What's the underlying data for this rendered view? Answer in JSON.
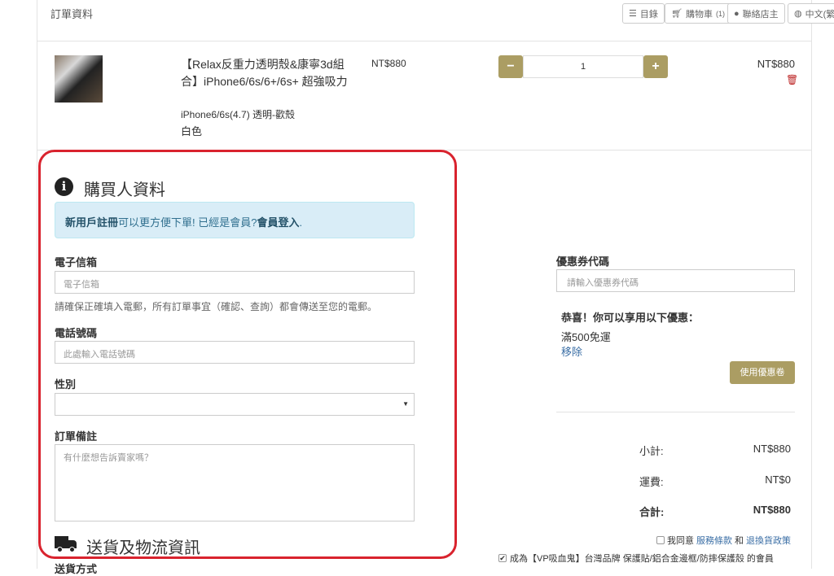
{
  "header": {
    "title": "訂單資料"
  },
  "nav": {
    "menu": "目錄",
    "cart": "購物車",
    "cart_count": "(1)",
    "contact": "聯絡店主",
    "language": "中文(繁"
  },
  "product": {
    "name": "【Relax反重力透明殼&康寧3d組合】iPhone6/6s/6+/6s+ 超強吸力",
    "variant": "iPhone6/6s(4.7) 透明-歡殼",
    "color": "白色",
    "unit_price": "NT$880",
    "quantity": "1",
    "total": "NT$880"
  },
  "buyer": {
    "title": "購買人資料",
    "alert_register": "新用戶註冊",
    "alert_mid": "可以更方便下單! 已經是會員?",
    "alert_login": "會員登入",
    "alert_end": ".",
    "email_label": "電子信箱",
    "email_placeholder": "電子信箱",
    "email_help": "請確保正確填入電郵，所有訂單事宜（確認、查詢）都會傳送至您的電郵。",
    "phone_label": "電話號碼",
    "phone_placeholder": "此處輸入電話號碼",
    "gender_label": "性別",
    "gender_value": "",
    "note_label": "訂單備註",
    "note_placeholder": "有什麼想告訴賣家嗎？"
  },
  "shipping": {
    "title": "送貨及物流資訊",
    "method_label": "送貨方式"
  },
  "coupon": {
    "label": "優惠券代碼",
    "placeholder": "請輸入優惠券代碼",
    "congrats": "恭喜！你可以享用以下優惠：",
    "offer": "滿500免運",
    "remove": "移除",
    "apply": "使用優惠卷"
  },
  "summary": {
    "subtotal_label": "小計:",
    "subtotal": "NT$880",
    "shipping_label": "運費:",
    "shipping": "NT$0",
    "total_label": "合計:",
    "total": "NT$880"
  },
  "agree": {
    "prefix": "我同意",
    "terms": "服務條款",
    "and": "和",
    "policy": "退換貨政策",
    "member": "成為【VP吸血鬼】台灣品牌 保護貼/鋁合金邊框/防摔保護殼 的會員"
  },
  "colors": {
    "accent": "#ab9d63",
    "highlight": "#d9232e"
  }
}
